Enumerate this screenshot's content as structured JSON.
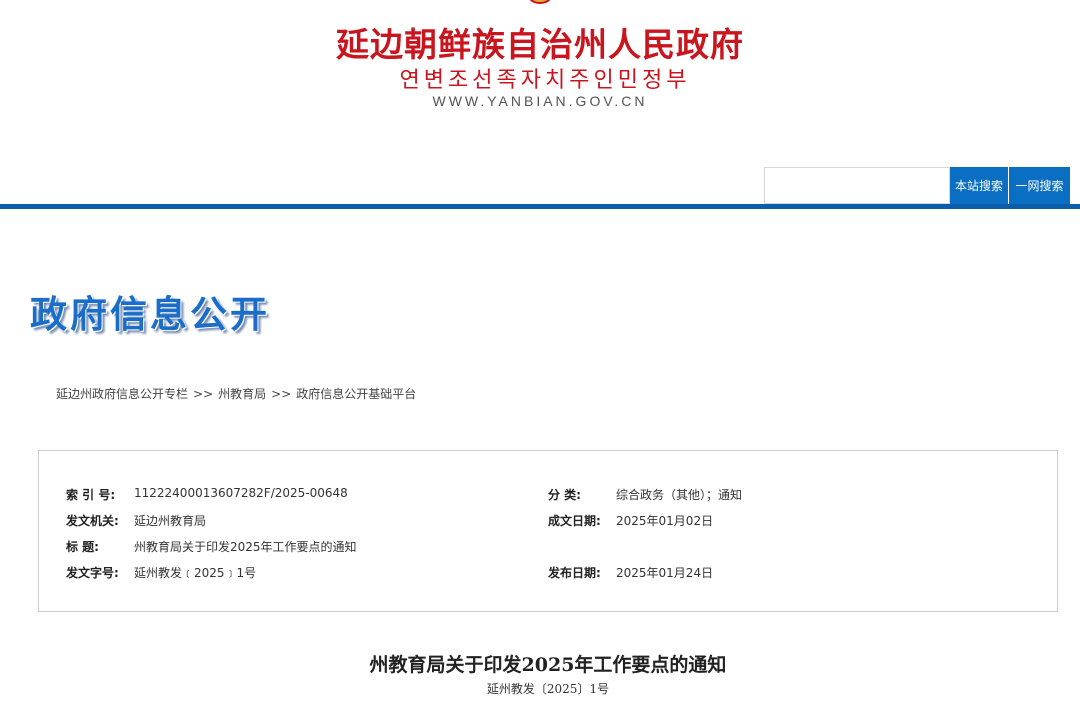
{
  "header": {
    "title": "延边朝鲜族自治州人民政府",
    "subtitle": "연변조선족자치주인민정부",
    "url": "WWW.YANBIAN.GOV.CN"
  },
  "search": {
    "placeholder": "",
    "site_search_label": "本站搜索",
    "all_search_label": "一网搜索"
  },
  "section": {
    "title": "政府信息公开"
  },
  "breadcrumb": {
    "items": [
      "延边州政府信息公开专栏",
      "州教育局",
      "政府信息公开基础平台"
    ],
    "separator": ">>"
  },
  "meta": {
    "index_label": "索 引 号:",
    "index_value": "11222400013607282F/2025-00648",
    "category_label": "分    类:",
    "category_value": "综合政务（其他）；通知",
    "issuer_label": "发文机关:",
    "issuer_value": "延边州教育局",
    "created_label": "成文日期:",
    "created_value": "2025年01月02日",
    "title_label": "标      题:",
    "title_value": "州教育局关于印发2025年工作要点的通知",
    "docno_label": "发文字号:",
    "docno_value": "延州教发﹝2025﹞1号",
    "published_label": "发布日期:",
    "published_value": "2025年01月24日"
  },
  "document": {
    "title": "州教育局关于印发2025年工作要点的通知",
    "number": "延州教发〔2025〕1号"
  },
  "colors": {
    "brand_red": "#c9151e",
    "brand_blue": "#0d5eaa",
    "button_blue": "#0a6fc2"
  }
}
